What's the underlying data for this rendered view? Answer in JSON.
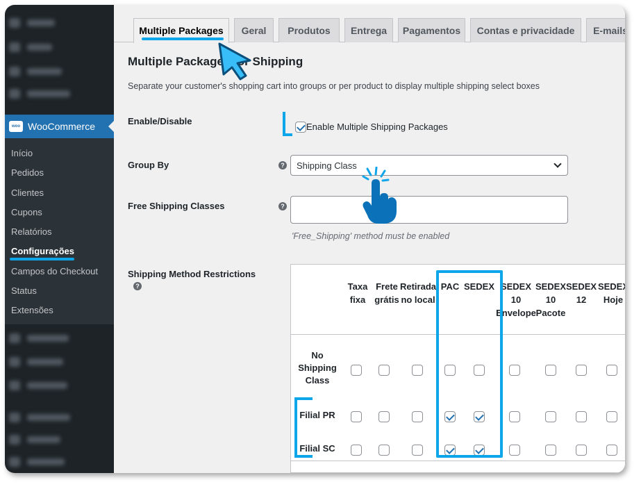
{
  "sidebar": {
    "woocommerce_label": "WooCommerce",
    "woo_logo_text": "woo",
    "submenu": [
      "Início",
      "Pedidos",
      "Clientes",
      "Cupons",
      "Relatórios",
      "Configurações",
      "Campos do Checkout",
      "Status",
      "Extensões"
    ],
    "active_submenu": "Configurações"
  },
  "tabs": [
    "Multiple Packages",
    "Geral",
    "Produtos",
    "Entrega",
    "Pagamentos",
    "Contas e privacidade",
    "E-mails"
  ],
  "active_tab": "Multiple Packages",
  "section": {
    "title": "Multiple Packages for Shipping",
    "description": "Separate your customer's shopping cart into groups or per product to display multiple shipping select boxes"
  },
  "enable": {
    "label": "Enable/Disable",
    "checkbox_label": "Enable Multiple Shipping Packages",
    "checked": true
  },
  "group_by": {
    "label": "Group By",
    "value": "Shipping Class",
    "help": "?"
  },
  "free_shipping": {
    "label": "Free Shipping Classes",
    "value": "",
    "note": "'Free_Shipping' method must be enabled",
    "help": "?"
  },
  "restrictions": {
    "label": "Shipping Method Restrictions",
    "help": "?",
    "columns": [
      "Taxa\nfixa",
      "Frete\ngrátis",
      "Retirada\nno local",
      "PAC",
      "SEDEX",
      "SEDEX\n10\nEnvelope",
      "SEDEX\n10\nPacote",
      "SEDEX\n12",
      "SEDEX\nHoje"
    ],
    "rows": [
      {
        "label": "No\nShipping\nClass",
        "checked": [
          false,
          false,
          false,
          false,
          false,
          false,
          false,
          false,
          false
        ]
      },
      {
        "label": "Filial PR",
        "checked": [
          false,
          false,
          false,
          true,
          true,
          false,
          false,
          false,
          false
        ]
      },
      {
        "label": "Filial SC",
        "checked": [
          false,
          false,
          false,
          true,
          true,
          false,
          false,
          false,
          false
        ]
      }
    ]
  },
  "colors": {
    "accent": "#0ea5e9",
    "wp_blue": "#2271b1",
    "sidebar_bg": "#1d2327"
  }
}
